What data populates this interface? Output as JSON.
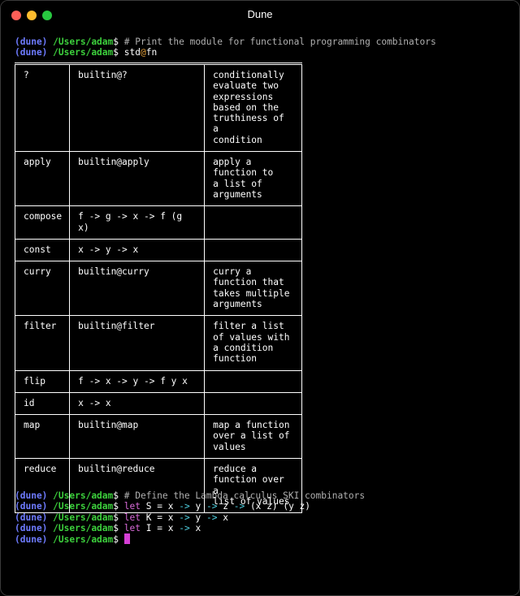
{
  "window": {
    "title": "Dune"
  },
  "colors": {
    "env": "#6e7bff",
    "path": "#3ccf3c",
    "keyword": "#d86ad8",
    "arrow": "#4fd0e0",
    "cursor": "#d63fd6"
  },
  "prompt": {
    "env": "(dune)",
    "path": "/Users/adam",
    "symbol": "$"
  },
  "session1": {
    "comment": "# Print the module for functional programming combinators",
    "cmd_module": "std",
    "cmd_at": "@",
    "cmd_member": "fn"
  },
  "table": {
    "rows": [
      {
        "name": "?",
        "impl": "builtin@?",
        "desc": [
          "conditionally",
          "evaluate two",
          "expressions",
          "based on the",
          "truthiness of a",
          "condition"
        ]
      },
      {
        "name": "apply",
        "impl": "builtin@apply",
        "desc": [
          "apply a",
          "function to",
          "a list of",
          "arguments"
        ]
      },
      {
        "name": "compose",
        "impl": "f -> g -> x -> f (g x)",
        "desc": []
      },
      {
        "name": "const",
        "impl": "x -> y -> x",
        "desc": []
      },
      {
        "name": "curry",
        "impl": "builtin@curry",
        "desc": [
          "curry a",
          "function that",
          "takes multiple",
          "arguments"
        ]
      },
      {
        "name": "filter",
        "impl": "builtin@filter",
        "desc": [
          "filter a list",
          "of values with",
          "a condition",
          "function"
        ]
      },
      {
        "name": "flip",
        "impl": "f -> x -> y -> f y x",
        "desc": []
      },
      {
        "name": "id",
        "impl": "x -> x",
        "desc": []
      },
      {
        "name": "map",
        "impl": "builtin@map",
        "desc": [
          "map a function",
          "over a list of",
          "values"
        ]
      },
      {
        "name": "reduce",
        "impl": "builtin@reduce",
        "desc": [
          "reduce a",
          "function over a",
          "list of values"
        ]
      }
    ]
  },
  "session2": {
    "comment": "# Define the Lambda calculus SKI combinators",
    "let_kw": "let",
    "arrow": "->",
    "eq": "=",
    "s_name": "S",
    "s_x": "x",
    "s_y": "y",
    "s_z": "z",
    "s_body": "(x z) (y z)",
    "k_name": "K",
    "k_x": "x",
    "k_y": "y",
    "k_body": "x",
    "i_name": "I",
    "i_x": "x",
    "i_body": "x"
  }
}
